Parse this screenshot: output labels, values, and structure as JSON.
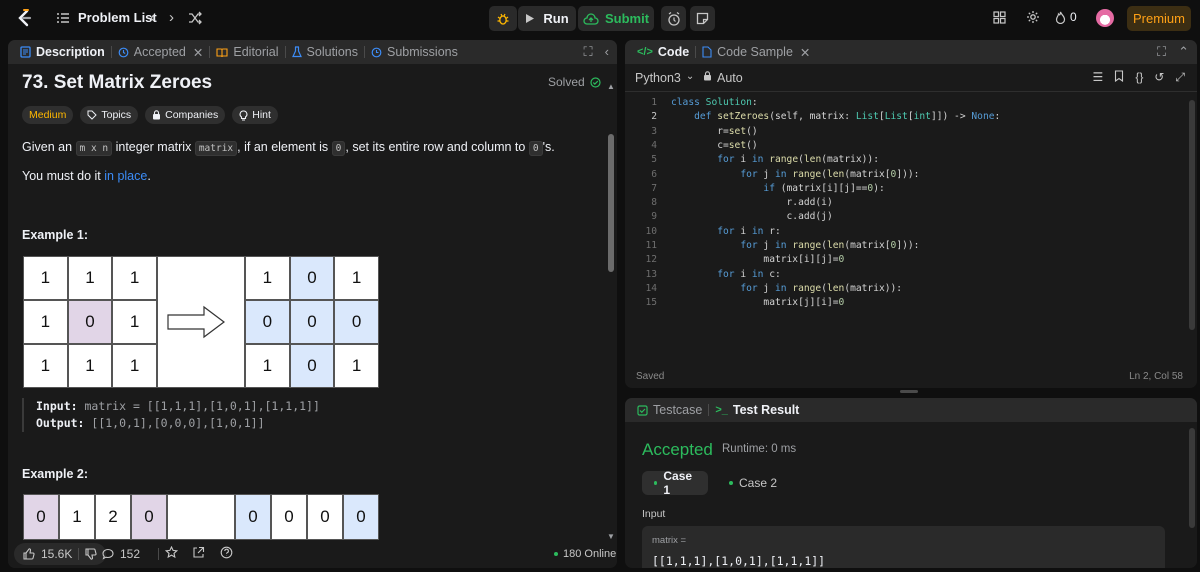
{
  "topbar": {
    "problem_list": "Problem List",
    "run": "Run",
    "submit": "Submit",
    "streak": "0",
    "premium": "Premium"
  },
  "left": {
    "tabs": [
      {
        "label": "Description",
        "icon": "description-icon"
      },
      {
        "label": "Accepted",
        "icon": "history-icon"
      },
      {
        "label": "Editorial",
        "icon": "book-icon"
      },
      {
        "label": "Solutions",
        "icon": "flask-icon"
      },
      {
        "label": "Submissions",
        "icon": "clock-icon"
      }
    ],
    "title": "73. Set Matrix Zeroes",
    "solved": "Solved",
    "chips": [
      "Medium",
      "Topics",
      "Companies",
      "Hint"
    ],
    "desc": {
      "p1": "Given an",
      "code1": "m x n",
      "p2": "integer matrix",
      "code2": "matrix",
      "p3": ", if an element is",
      "code3": "0",
      "p4": ", set its entire row and column to",
      "code4": "0",
      "p5": "'s.",
      "l1": "You must do it",
      "link": "in place",
      "l2": "."
    },
    "example1": {
      "title": "Example 1:",
      "input_label": "Input:",
      "input_value": "matrix = [[1,1,1],[1,0,1],[1,1,1]]",
      "output_label": "Output:",
      "output_value": "[[1,0,1],[0,0,0],[1,0,1]]",
      "before": [
        [
          "1",
          "1",
          "1"
        ],
        [
          "1",
          "0",
          "1"
        ],
        [
          "1",
          "1",
          "1"
        ]
      ],
      "after": [
        [
          "1",
          "0",
          "1"
        ],
        [
          "0",
          "0",
          "0"
        ],
        [
          "1",
          "0",
          "1"
        ]
      ]
    },
    "example2": {
      "title": "Example 2:",
      "before_row": [
        "0",
        "1",
        "2",
        "0"
      ],
      "after_row": [
        "0",
        "0",
        "0",
        "0"
      ]
    },
    "footer": {
      "likes": "15.6K",
      "comments": "152",
      "online": "180 Online"
    }
  },
  "code": {
    "tabs": [
      "Code",
      "Code Sample"
    ],
    "language": "Python3",
    "mode": "Auto",
    "line_numbers": [
      "1",
      "2",
      "3",
      "4",
      "5",
      "6",
      "7",
      "8",
      "9",
      "10",
      "11",
      "12",
      "13",
      "14",
      "15"
    ],
    "status": "Saved",
    "cursor": "Ln 2, Col 58"
  },
  "test": {
    "tabs": [
      "Testcase",
      "Test Result"
    ],
    "result": "Accepted",
    "runtime": "Runtime: 0 ms",
    "cases": [
      "Case 1",
      "Case 2"
    ],
    "input_label": "Input",
    "var_name": "matrix =",
    "var_value": "[[1,1,1],[1,0,1],[1,1,1]]"
  }
}
